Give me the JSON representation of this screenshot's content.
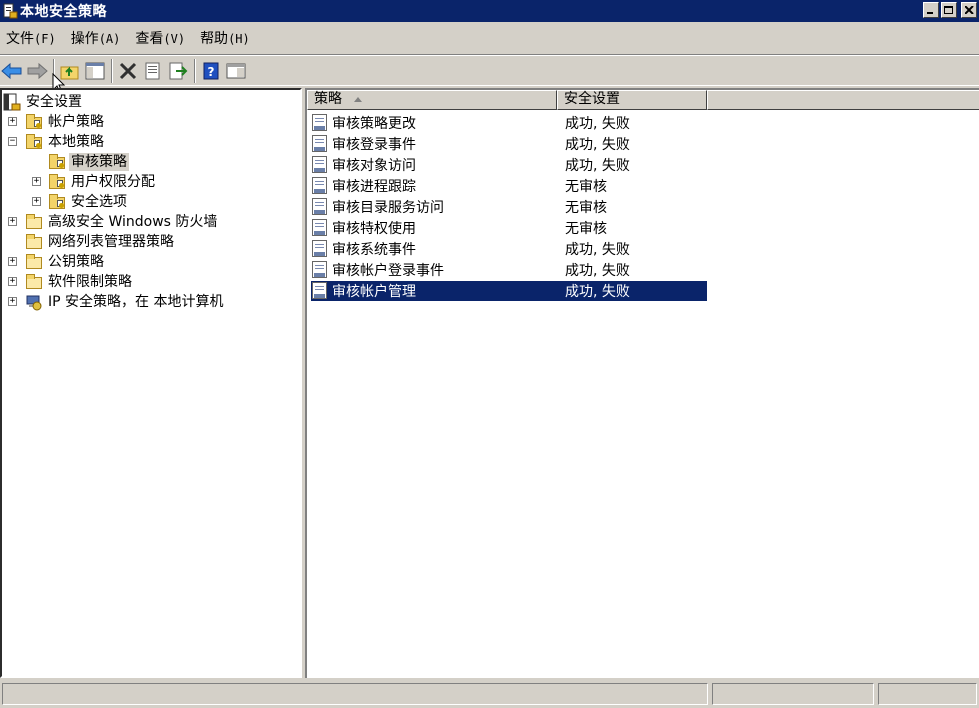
{
  "window": {
    "title": "本地安全策略",
    "buttons": {
      "minimize": "_",
      "maximize": "□",
      "close": "×"
    }
  },
  "menu": [
    {
      "label": "文件",
      "accel": "(F)"
    },
    {
      "label": "操作",
      "accel": "(A)"
    },
    {
      "label": "查看",
      "accel": "(V)"
    },
    {
      "label": "帮助",
      "accel": "(H)"
    }
  ],
  "toolbar": {
    "icons": [
      "back-icon",
      "forward-icon",
      "up-folder-icon",
      "show-hide-tree-icon",
      "delete-icon",
      "properties-icon",
      "export-list-icon",
      "help-icon",
      "console-view-icon"
    ]
  },
  "tree": {
    "root": "安全设置",
    "items": [
      {
        "label": "帐户策略"
      },
      {
        "label": "本地策略"
      },
      {
        "label": "审核策略"
      },
      {
        "label": "用户权限分配"
      },
      {
        "label": "安全选项"
      },
      {
        "label": "高级安全 Windows 防火墙"
      },
      {
        "label": "网络列表管理器策略"
      },
      {
        "label": "公钥策略"
      },
      {
        "label": "软件限制策略"
      },
      {
        "label": "IP 安全策略，在 本地计算机"
      }
    ]
  },
  "list": {
    "columns": [
      "策略",
      "安全设置"
    ],
    "rows": [
      {
        "policy": "审核策略更改",
        "setting": "成功, 失败"
      },
      {
        "policy": "审核登录事件",
        "setting": "成功, 失败"
      },
      {
        "policy": "审核对象访问",
        "setting": "成功, 失败"
      },
      {
        "policy": "审核进程跟踪",
        "setting": "无审核"
      },
      {
        "policy": "审核目录服务访问",
        "setting": "无审核"
      },
      {
        "policy": "审核特权使用",
        "setting": "无审核"
      },
      {
        "policy": "审核系统事件",
        "setting": "成功, 失败"
      },
      {
        "policy": "审核帐户登录事件",
        "setting": "成功, 失败"
      },
      {
        "policy": "审核帐户管理",
        "setting": "成功, 失败"
      }
    ],
    "selected_row": 8
  },
  "colors": {
    "titlebar": "#0a246a",
    "selection": "#0a246a",
    "chrome": "#d4d0c8"
  }
}
